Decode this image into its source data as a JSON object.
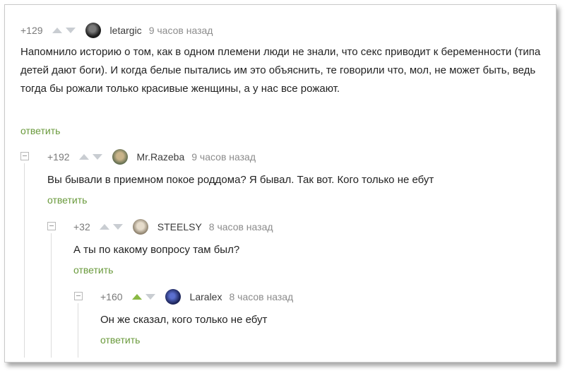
{
  "comments": [
    {
      "rating": "+129",
      "username": "letargic",
      "time": "9 часов назад",
      "text": "Напомнило историю о том, как в одном племени люди не знали, что секс приводит к беременности (типа детей дают боги). И когда белые пытались им это объяснить, те говорили что, мол, не может быть, ведь тогда бы рожали только красивые женщины, а у нас все рожают.",
      "reply": "ответить",
      "upvoted": false
    },
    {
      "rating": "+192",
      "username": "Mr.Razeba",
      "time": "9 часов назад",
      "text": "Вы бывали в приемном покое роддома? Я бывал. Так вот. Кого только не ебут",
      "reply": "ответить",
      "upvoted": false
    },
    {
      "rating": "+32",
      "username": "STEELSY",
      "time": "8 часов назад",
      "text": "А ты по какому вопросу там был?",
      "reply": "ответить",
      "upvoted": false
    },
    {
      "rating": "+160",
      "username": "Laralex",
      "time": "8 часов назад",
      "text": "Он же сказал, кого только не ебут",
      "reply": "ответить",
      "upvoted": true
    }
  ],
  "colors": {
    "reply_link": "#6a9a3c",
    "upvote_active": "#8ab944",
    "vote_inactive": "#c9cdd2"
  }
}
